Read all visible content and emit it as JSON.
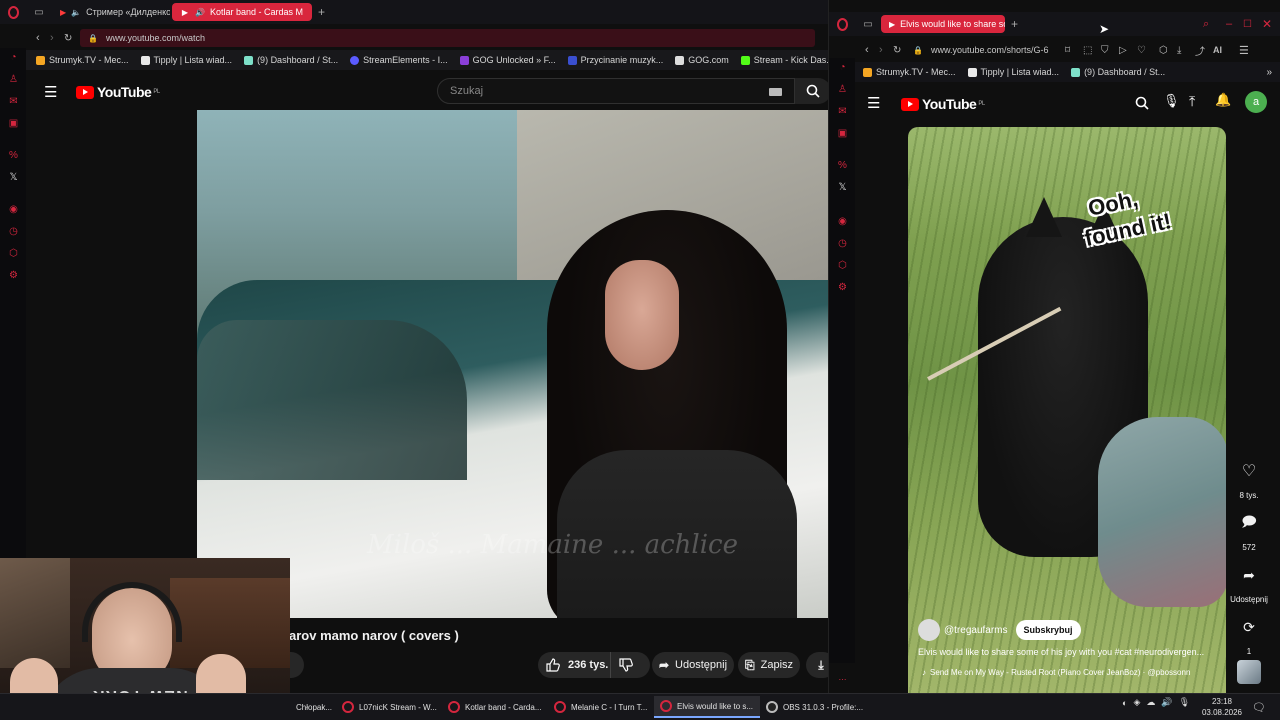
{
  "left_browser": {
    "tabs": [
      {
        "label": "Стример «Дилденко Т"
      },
      {
        "label": "Kotlar band - Cardas M"
      }
    ],
    "url": "www.youtube.com/watch",
    "bookmarks": [
      "Strumyk.TV - Mec...",
      "Tipply | Lista wiad...",
      "(9) Dashboard / St...",
      "StreamElements - I...",
      "GOG Unlocked » F...",
      "Przycinanie muzyk...",
      "GOG.com",
      "Stream - Kick Das..."
    ],
    "youtube": {
      "logo": "YouTube",
      "region": "PL",
      "search_placeholder": "Szukaj"
    },
    "video": {
      "title": "arov mamo narov ( covers )",
      "watermark": "Miloš ... Mamaine ... achlice",
      "like_count": "236 tys.",
      "share_label": "Udostępnij",
      "save_label": "Zapisz"
    }
  },
  "right_browser": {
    "tab_label": "Elvis would like to share so",
    "url": "www.youtube.com/shorts/G-6",
    "bookmarks": [
      "Strumyk.TV - Mec...",
      "Tipply | Lista wiad...",
      "(9) Dashboard / St..."
    ],
    "ai_label": "AI",
    "youtube": {
      "logo": "YouTube",
      "region": "PL",
      "avatar_letter": "a"
    },
    "short": {
      "overlay_text_line1": "Ooh,",
      "overlay_text_line2": "found it!",
      "channel": "@tregaufarms",
      "subscribe_label": "Subskrybuj",
      "description": "Elvis would like to share some of his joy with you #cat #neurodivergen...",
      "music": "Send Me on My Way - Rusted Root (Piano Cover JeanBoz) · @pbossonn",
      "likes": "8 tys.",
      "comments": "572",
      "share_label": "Udostępnij",
      "remix_count": "1"
    }
  },
  "taskbar": {
    "items": [
      "Chłopak...",
      "L07nicK Stream - W...",
      "Kotlar band - Carda...",
      "Melanie C - I Turn T...",
      "Elvis would like to s...",
      "OBS 31.0.3 - Profile:..."
    ],
    "time": "23:18",
    "date": "03.08.2026"
  },
  "webcam": {
    "shirt_text": "NEW YORK"
  },
  "colors": {
    "opera_red": "#d4263e",
    "yt_red": "#ff0000",
    "active_tab": "#d9263d"
  }
}
